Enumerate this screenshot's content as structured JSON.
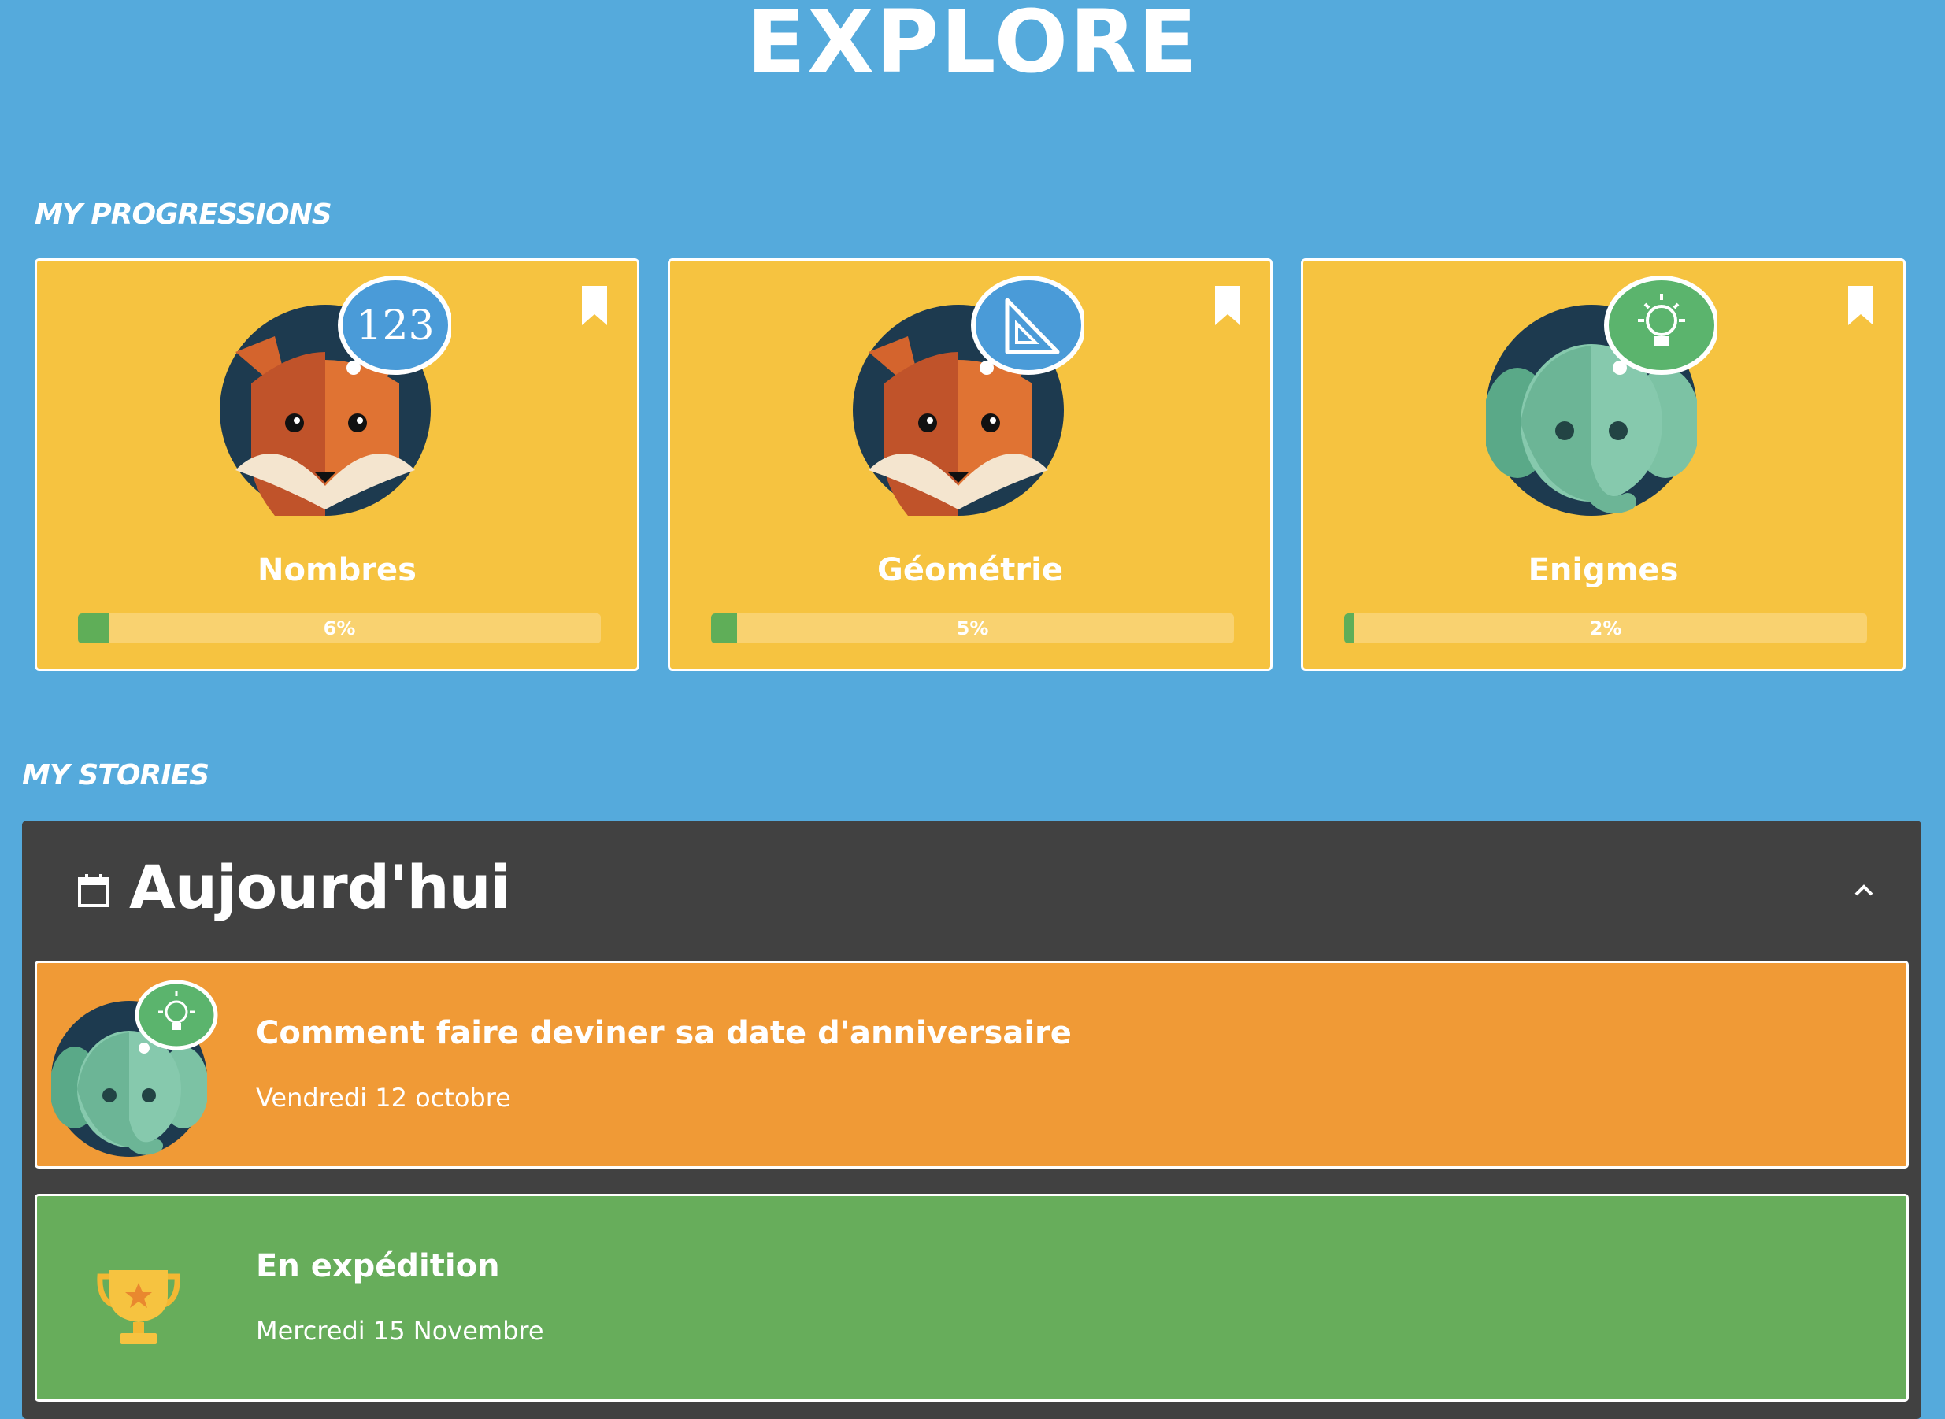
{
  "header": {
    "title": "EXPLORE"
  },
  "progressions": {
    "section_title": "MY PROGRESSIONS",
    "cards": [
      {
        "name": "Nombres",
        "progress_label": "6%",
        "progress": 0.06,
        "character": "fox",
        "badge": "123",
        "badge_color": "#4a9bd8"
      },
      {
        "name": "Géométrie",
        "progress_label": "5%",
        "progress": 0.05,
        "character": "fox",
        "badge": "set-square-icon",
        "badge_color": "#4a9bd8"
      },
      {
        "name": "Enigmes",
        "progress_label": "2%",
        "progress": 0.02,
        "character": "elephant",
        "badge": "lightbulb-icon",
        "badge_color": "#5bb46d"
      }
    ]
  },
  "stories": {
    "section_title": "MY STORIES",
    "day_label": "Aujourd'hui",
    "items": [
      {
        "title": "Comment faire deviner sa date d'anniversaire",
        "date": "Vendredi 12 octobre",
        "color": "#f09a36",
        "icon": "elephant-avatar"
      },
      {
        "title": "En expédition",
        "date": "Mercredi 15 Novembre",
        "color": "#67ad5b",
        "icon": "trophy-icon"
      }
    ]
  },
  "colors": {
    "background": "#55aadc",
    "card": "#f6c340",
    "progress_fill": "#5fae58",
    "panel": "#414141"
  }
}
